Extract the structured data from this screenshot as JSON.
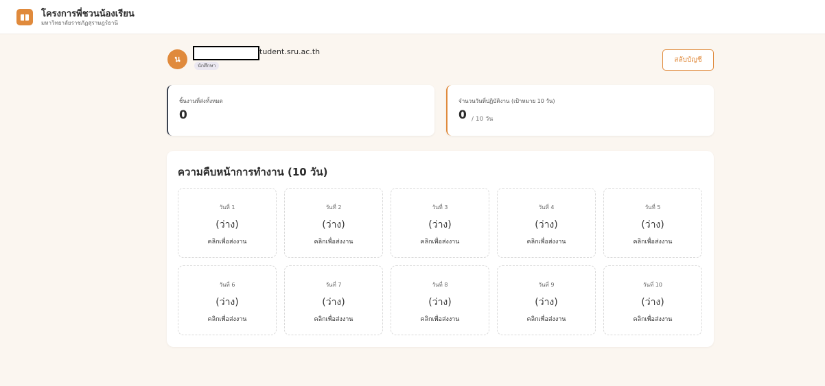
{
  "header": {
    "title": "โครงการพี่ชวนน้องเรียน",
    "subtitle": "มหาวิทยาลัยราชภัฏสุราษฎร์ธานี",
    "logo_icon": "book-icon",
    "accent_color": "#e08a3c"
  },
  "user": {
    "avatar_initial": "น",
    "email_visible": "tudent.sru.ac.th",
    "role": "นักศึกษา",
    "switch_account_label": "สลับบัญชี"
  },
  "stats": {
    "submitted": {
      "label": "ชิ้นงานที่ส่งทั้งหมด",
      "value": "0"
    },
    "days": {
      "label": "จำนวนวันที่ปฏิบัติงาน (เป้าหมาย 10 วัน)",
      "value": "0",
      "suffix": "/ 10 วัน"
    }
  },
  "progress": {
    "title": "ความคืบหน้าการทำงาน (10 วัน)",
    "days": [
      {
        "label": "วันที่ 1",
        "status": "(ว่าง)",
        "action": "คลิกเพื่อส่งงาน"
      },
      {
        "label": "วันที่ 2",
        "status": "(ว่าง)",
        "action": "คลิกเพื่อส่งงาน"
      },
      {
        "label": "วันที่ 3",
        "status": "(ว่าง)",
        "action": "คลิกเพื่อส่งงาน"
      },
      {
        "label": "วันที่ 4",
        "status": "(ว่าง)",
        "action": "คลิกเพื่อส่งงาน"
      },
      {
        "label": "วันที่ 5",
        "status": "(ว่าง)",
        "action": "คลิกเพื่อส่งงาน"
      },
      {
        "label": "วันที่ 6",
        "status": "(ว่าง)",
        "action": "คลิกเพื่อส่งงาน"
      },
      {
        "label": "วันที่ 7",
        "status": "(ว่าง)",
        "action": "คลิกเพื่อส่งงาน"
      },
      {
        "label": "วันที่ 8",
        "status": "(ว่าง)",
        "action": "คลิกเพื่อส่งงาน"
      },
      {
        "label": "วันที่ 9",
        "status": "(ว่าง)",
        "action": "คลิกเพื่อส่งงาน"
      },
      {
        "label": "วันที่ 10",
        "status": "(ว่าง)",
        "action": "คลิกเพื่อส่งงาน"
      }
    ]
  }
}
